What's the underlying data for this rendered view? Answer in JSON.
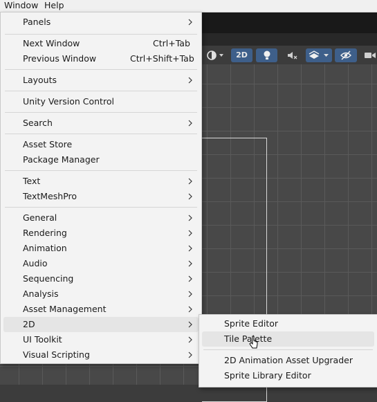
{
  "menubar": {
    "items": [
      "Window",
      "Help"
    ]
  },
  "window_menu": {
    "items": [
      {
        "label": "Panels",
        "submenu": true
      },
      {
        "label": "Next Window",
        "shortcut": "Ctrl+Tab"
      },
      {
        "label": "Previous Window",
        "shortcut": "Ctrl+Shift+Tab"
      },
      {
        "label": "Layouts",
        "submenu": true
      },
      {
        "label": "Unity Version Control"
      },
      {
        "label": "Search",
        "submenu": true
      },
      {
        "label": "Asset Store"
      },
      {
        "label": "Package Manager"
      },
      {
        "label": "Text",
        "submenu": true
      },
      {
        "label": "TextMeshPro",
        "submenu": true
      },
      {
        "label": "General",
        "submenu": true
      },
      {
        "label": "Rendering",
        "submenu": true
      },
      {
        "label": "Animation",
        "submenu": true
      },
      {
        "label": "Audio",
        "submenu": true
      },
      {
        "label": "Sequencing",
        "submenu": true
      },
      {
        "label": "Analysis",
        "submenu": true
      },
      {
        "label": "Asset Management",
        "submenu": true
      },
      {
        "label": "2D",
        "submenu": true,
        "highlighted": true
      },
      {
        "label": "UI Toolkit",
        "submenu": true
      },
      {
        "label": "Visual Scripting",
        "submenu": true
      }
    ]
  },
  "submenu_2d": {
    "items": [
      {
        "label": "Sprite Editor"
      },
      {
        "label": "Tile Palette",
        "highlighted": true
      },
      {
        "label": "2D Animation Asset Upgrader"
      },
      {
        "label": "Sprite Library Editor"
      }
    ]
  },
  "toolbar": {
    "mode_2d_label": "2D"
  },
  "colors": {
    "menu_bg": "#f3f3f3",
    "highlight": "#e5e5e5",
    "scene_bg": "#484848",
    "active_button": "#3e5f8a"
  }
}
